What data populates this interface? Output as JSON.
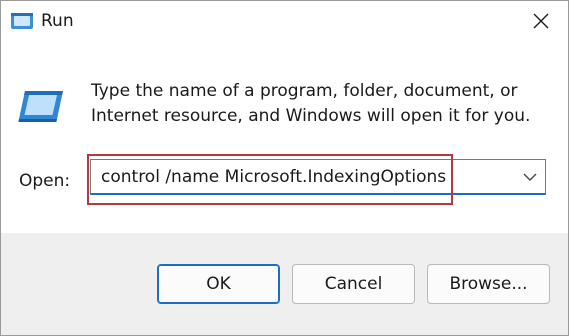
{
  "window": {
    "title": "Run",
    "description": "Type the name of a program, folder, document, or Internet resource, and Windows will open it for you.",
    "open_label": "Open:",
    "command_value": "control /name Microsoft.IndexingOptions",
    "buttons": {
      "ok": "OK",
      "cancel": "Cancel",
      "browse": "Browse..."
    }
  },
  "icons": {
    "app": "run-app-icon",
    "close": "close-icon",
    "dropdown": "chevron-down-icon"
  },
  "colors": {
    "accent": "#1d6ec2",
    "highlight": "#b53a3f",
    "footer_bg": "#efefef"
  }
}
